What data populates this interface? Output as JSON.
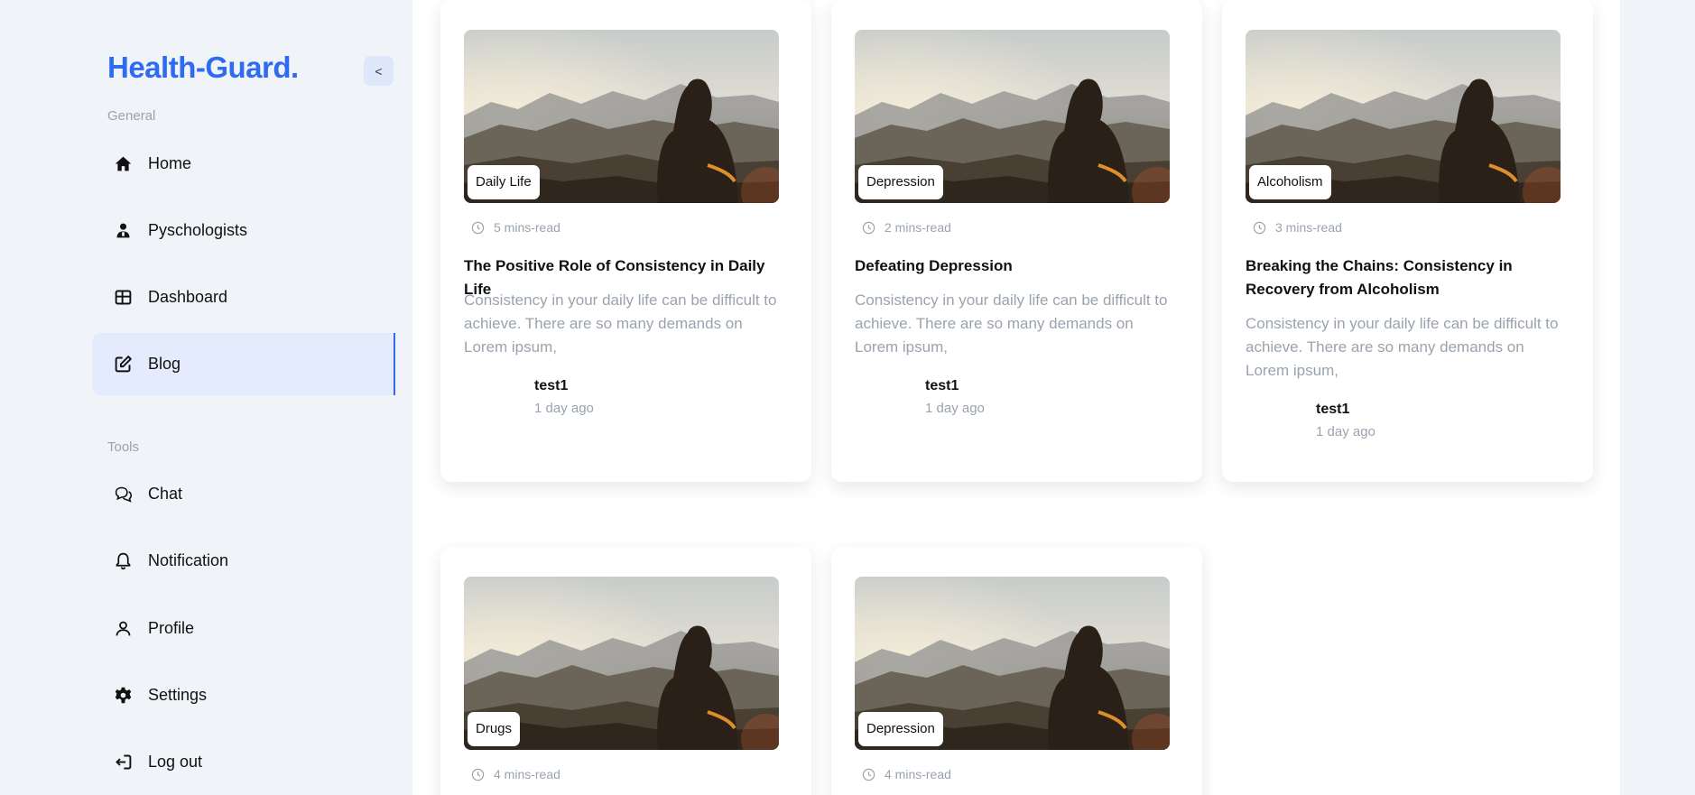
{
  "sidebar": {
    "brand": "Health-Guard.",
    "collapse_label": "<",
    "section_general": "General",
    "section_tools": "Tools",
    "items": [
      {
        "label": "Home",
        "icon": "home-icon"
      },
      {
        "label": "Pyschologists",
        "icon": "psychologist-icon"
      },
      {
        "label": "Dashboard",
        "icon": "dashboard-icon"
      },
      {
        "label": "Blog",
        "icon": "edit-icon",
        "active": true
      },
      {
        "label": "Chat",
        "icon": "chat-icon"
      },
      {
        "label": "Notification",
        "icon": "bell-icon"
      },
      {
        "label": "Profile",
        "icon": "user-icon"
      },
      {
        "label": "Settings",
        "icon": "gear-icon"
      },
      {
        "label": "Log out",
        "icon": "logout-icon"
      }
    ]
  },
  "colors": {
    "accent": "#2f6bf0",
    "muted": "#9aa3ae",
    "active_bg": "#e3ebfc"
  },
  "posts": [
    {
      "tag": "Daily Life",
      "read_time": "5 mins-read",
      "title": "The Positive Role of Consistency in Daily Life",
      "excerpt": "Consistency in your daily life can be difficult to achieve. There are so many demands on Lorem ipsum,",
      "author": "test1",
      "ago": "1 day ago"
    },
    {
      "tag": "Depression",
      "read_time": "2 mins-read",
      "title": "Defeating Depression",
      "excerpt": "Consistency in your daily life can be difficult to achieve. There are so many demands on Lorem ipsum,",
      "author": "test1",
      "ago": "1 day ago"
    },
    {
      "tag": "Alcoholism",
      "read_time": "3 mins-read",
      "title": "Breaking the Chains: Consistency in Recovery from Alcoholism",
      "excerpt": "Consistency in your daily life can be difficult to achieve. There are so many demands on Lorem ipsum,",
      "author": "test1",
      "ago": "1 day ago"
    },
    {
      "tag": "Drugs",
      "read_time": "4 mins-read"
    },
    {
      "tag": "Depression",
      "read_time": "4 mins-read"
    }
  ]
}
